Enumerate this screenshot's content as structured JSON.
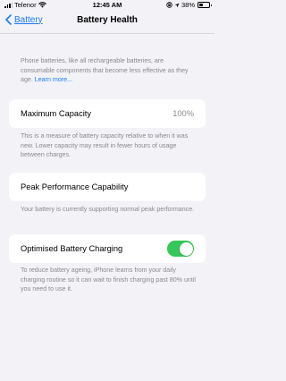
{
  "status_bar": {
    "carrier": "Telenor",
    "time": "12:45 AM",
    "battery_percent": "38%",
    "battery_level": 0.38,
    "icons": [
      "signal-icon",
      "wifi-icon",
      "orientation-lock-icon",
      "location-icon",
      "battery-icon"
    ]
  },
  "nav": {
    "back_label": "Battery",
    "title": "Battery Health"
  },
  "intro": {
    "text": "Phone batteries, like all rechargeable batteries, are consumable components that become less effective as they age.",
    "link": "Learn more..."
  },
  "maximum_capacity": {
    "label": "Maximum Capacity",
    "value": "100%",
    "note": "This is a measure of battery capacity relative to when it was new. Lower capacity may result in fewer hours of usage between charges."
  },
  "peak_performance": {
    "label": "Peak Performance Capability",
    "note": "Your battery is currently supporting normal peak performance."
  },
  "optimised_charging": {
    "label": "Optimised Battery Charging",
    "enabled": true,
    "note": "To reduce battery ageing, iPhone learns from your daily charging routine so it can wait to finish charging past 80% until you need to use it."
  },
  "colors": {
    "accent": "#1a7cf5",
    "toggle_on": "#34c759",
    "background": "#f2f2f7",
    "secondary_text": "#8a8a8e"
  }
}
